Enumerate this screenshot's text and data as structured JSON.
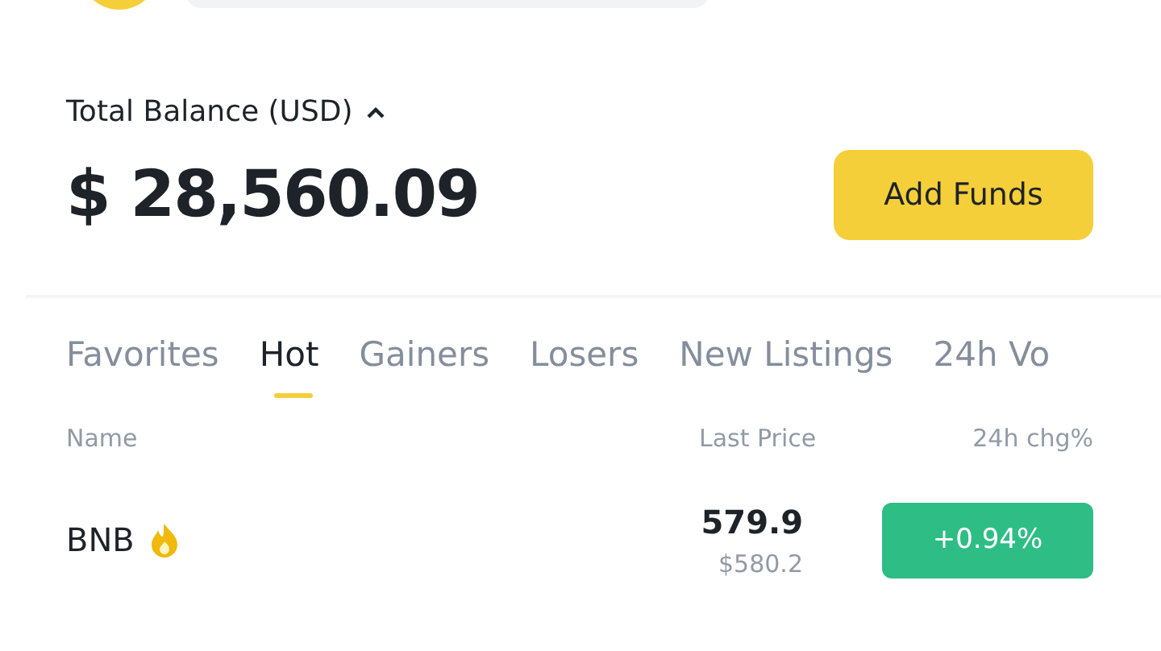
{
  "balance": {
    "label": "Total Balance (USD)",
    "expanded": true,
    "currency": "$",
    "amount": "28,560.09"
  },
  "add_funds": "Add Funds",
  "tabs": [
    {
      "label": "Favorites",
      "selected": false
    },
    {
      "label": "Hot",
      "selected": true
    },
    {
      "label": "Gainers",
      "selected": false
    },
    {
      "label": "Losers",
      "selected": false
    },
    {
      "label": "New Listings",
      "selected": false
    },
    {
      "label": "24h Vo",
      "selected": false
    }
  ],
  "table": {
    "columns": [
      "Name",
      "Last Price",
      "24h chg%"
    ],
    "rows": [
      {
        "name": "BNB",
        "hot": true,
        "price": "579.9",
        "fiat_price": "$580.2",
        "change": "+0.94%",
        "positive": true
      }
    ]
  }
}
